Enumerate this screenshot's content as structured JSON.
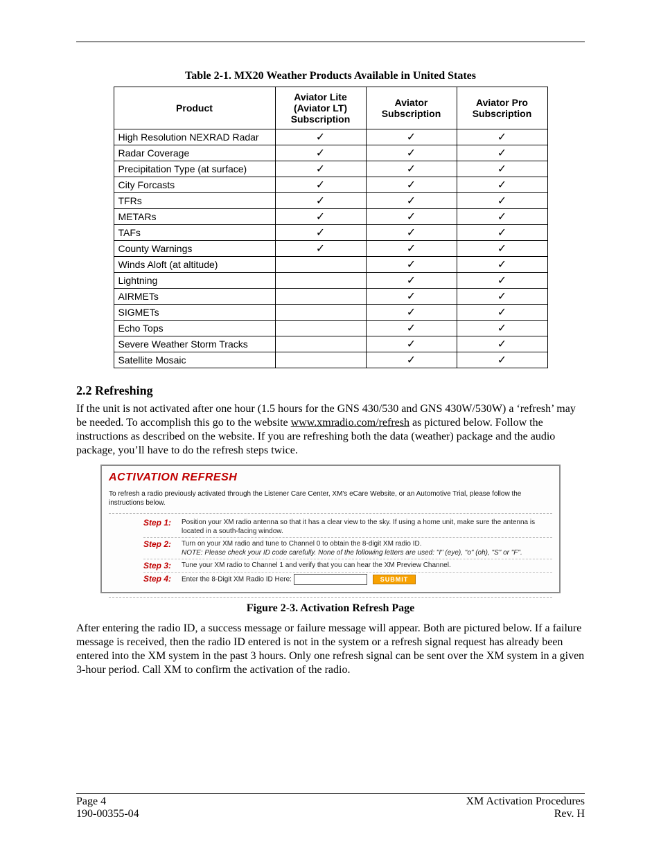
{
  "tableCaption": "Table 2-1.  MX20 Weather Products Available in United States",
  "headers": {
    "product": "Product",
    "lite": "Aviator Lite (Aviator LT) Subscription",
    "av": "Aviator Subscription",
    "pro": "Aviator Pro Subscription"
  },
  "checkGlyph": "✓",
  "rows": [
    {
      "name": "High Resolution NEXRAD Radar",
      "lite": true,
      "av": true,
      "pro": true
    },
    {
      "name": "Radar Coverage",
      "lite": true,
      "av": true,
      "pro": true
    },
    {
      "name": "Precipitation Type (at surface)",
      "lite": true,
      "av": true,
      "pro": true
    },
    {
      "name": "City Forcasts",
      "lite": true,
      "av": true,
      "pro": true
    },
    {
      "name": "TFRs",
      "lite": true,
      "av": true,
      "pro": true
    },
    {
      "name": "METARs",
      "lite": true,
      "av": true,
      "pro": true
    },
    {
      "name": "TAFs",
      "lite": true,
      "av": true,
      "pro": true
    },
    {
      "name": "County Warnings",
      "lite": true,
      "av": true,
      "pro": true
    },
    {
      "name": "Winds Aloft (at altitude)",
      "lite": false,
      "av": true,
      "pro": true
    },
    {
      "name": "Lightning",
      "lite": false,
      "av": true,
      "pro": true
    },
    {
      "name": "AIRMETs",
      "lite": false,
      "av": true,
      "pro": true
    },
    {
      "name": "SIGMETs",
      "lite": false,
      "av": true,
      "pro": true
    },
    {
      "name": "Echo Tops",
      "lite": false,
      "av": true,
      "pro": true
    },
    {
      "name": "Severe Weather Storm Tracks",
      "lite": false,
      "av": true,
      "pro": true
    },
    {
      "name": "Satellite Mosaic",
      "lite": false,
      "av": true,
      "pro": true
    }
  ],
  "sectionHeading": "2.2  Refreshing",
  "para1a": "If the unit is not activated after one hour (1.5 hours for the GNS 430/530 and GNS 430W/530W) a ‘refresh’ may be needed.  To accomplish this go to the website ",
  "para1link": "www.xmradio.com/refresh",
  "para1b": " as pictured below. Follow the instructions as described on the website. If you are refreshing both the data (weather) package and the audio package, you’ll have to do the refresh steps twice.",
  "activation": {
    "title": "ACTIVATION REFRESH",
    "intro": "To refresh a radio previously activated through the Listener Care Center, XM's eCare Website, or an Automotive Trial, please follow the instructions below.",
    "steps": [
      {
        "label": "Step 1:",
        "text": "Position your XM radio antenna so that it has a clear view to the sky. If using a home unit, make sure the antenna is located in a south-facing window."
      },
      {
        "label": "Step 2:",
        "text": "Turn on your XM radio and tune to Channel 0 to obtain the 8-digit XM radio ID.",
        "note": "NOTE: Please check your ID code carefully. None of the following letters are used: \"I\" (eye), \"o\" (oh), \"S\" or \"F\"."
      },
      {
        "label": "Step 3:",
        "text": "Tune your XM radio to Channel 1 and verify that you can hear the XM Preview Channel."
      },
      {
        "label": "Step 4:",
        "text": "Enter the 8-Digit XM Radio ID Here:"
      }
    ],
    "submit": "SUBMIT",
    "inputValue": ""
  },
  "figCaption": "Figure 2-3.  Activation Refresh Page",
  "para2": "After entering the radio ID, a success message or failure message will appear. Both are pictured below. If a failure message is received, then the radio ID entered is not in the system or a refresh signal request has already been entered into the XM system in the past 3 hours. Only one refresh signal can be sent over the XM system in a given 3-hour period. Call XM to confirm the activation of the radio.",
  "footer": {
    "leftTop": "Page 4",
    "leftBottom": "190-00355-04",
    "rightTop": "XM Activation Procedures",
    "rightBottom": "Rev. H"
  }
}
